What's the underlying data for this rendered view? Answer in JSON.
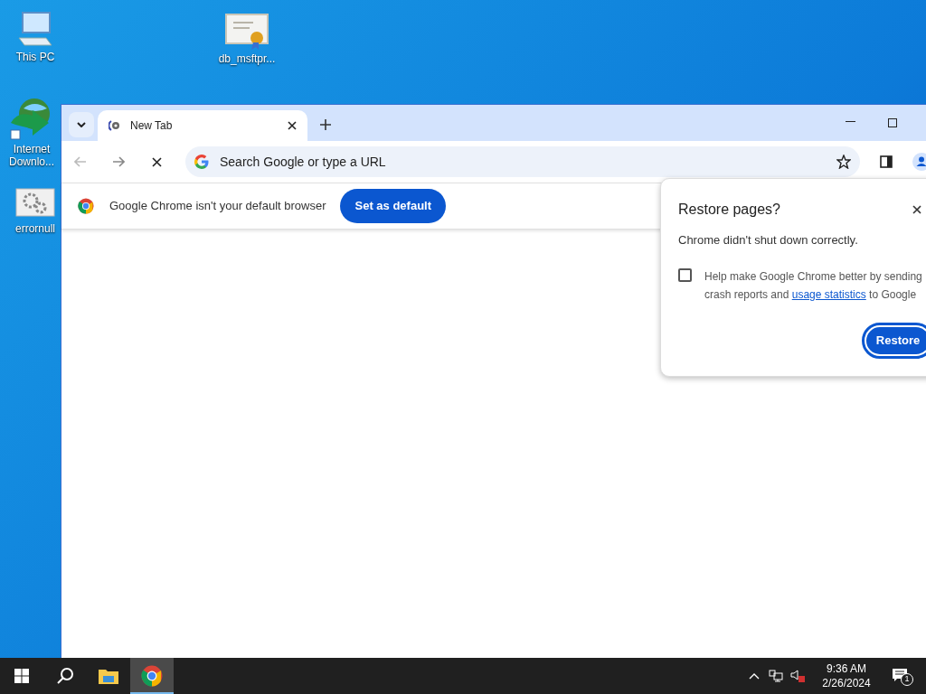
{
  "desktop_icons": [
    {
      "label": "This PC",
      "kind": "computer"
    },
    {
      "label": "db_msftpr...",
      "kind": "certificate"
    },
    {
      "label": "Internet Downlo...",
      "kind": "downloader"
    },
    {
      "label": "errornull",
      "kind": "gears"
    }
  ],
  "browser": {
    "tabs": [
      {
        "title": "New Tab",
        "selected": true
      }
    ],
    "address": {
      "placeholder": "Search Google or type a URL"
    },
    "infobar": {
      "message": "Google Chrome isn't your default browser",
      "button": "Set as default"
    }
  },
  "restore_dialog": {
    "title": "Restore pages?",
    "message": "Chrome didn't shut down correctly.",
    "checkbox": {
      "text_before": "Help make Google Chrome better by sending crash reports and ",
      "link": "usage statistics",
      "text_after": " to Google",
      "checked": false
    },
    "button": "Restore"
  },
  "taskbar": {
    "apps": [
      {
        "kind": "explorer",
        "selected": false
      },
      {
        "kind": "chrome",
        "selected": true
      }
    ],
    "time": "9:36 AM",
    "date": "2/26/2024",
    "notifications": "1"
  }
}
